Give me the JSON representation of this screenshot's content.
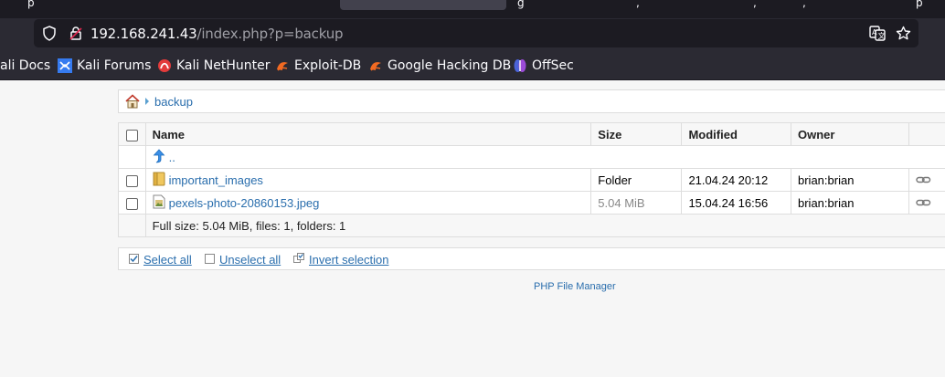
{
  "browser": {
    "tab_fragments": [
      "p",
      "",
      "g",
      ",",
      ",",
      ",",
      ",",
      "p"
    ],
    "url_host": "192.168.241.43",
    "url_path": "/index.php?p=backup",
    "bookmarks": [
      {
        "label": "ali Docs",
        "icon": "kali-docs-icon"
      },
      {
        "label": "Kali Forums",
        "icon": "kali-forums-icon"
      },
      {
        "label": "Kali NetHunter",
        "icon": "nethunter-icon"
      },
      {
        "label": "Exploit-DB",
        "icon": "exploit-db-icon"
      },
      {
        "label": "Google Hacking DB",
        "icon": "ghdb-icon"
      },
      {
        "label": "OffSec",
        "icon": "offsec-icon"
      }
    ]
  },
  "breadcrumb": {
    "folder": "backup"
  },
  "table": {
    "headers": {
      "name": "Name",
      "size": "Size",
      "modified": "Modified",
      "owner": "Owner"
    },
    "parent": "..",
    "rows": [
      {
        "name": "important_images",
        "type": "folder",
        "size": "Folder",
        "modified": "21.04.24 20:12",
        "owner": "brian:brian"
      },
      {
        "name": "pexels-photo-20860153.jpeg",
        "type": "image",
        "size": "5.04 MiB",
        "modified": "15.04.24 16:56",
        "owner": "brian:brian"
      }
    ],
    "summary": "Full size: 5.04 MiB, files: 1, folders: 1"
  },
  "actions": {
    "select_all": "Select all",
    "unselect_all": "Unselect all",
    "invert_selection": "Invert selection"
  },
  "footer": {
    "credit": "PHP File Manager"
  },
  "colors": {
    "link": "#2a6ead",
    "chrome_bg": "#2b2a33",
    "urlbar_bg": "#1c1b22"
  }
}
